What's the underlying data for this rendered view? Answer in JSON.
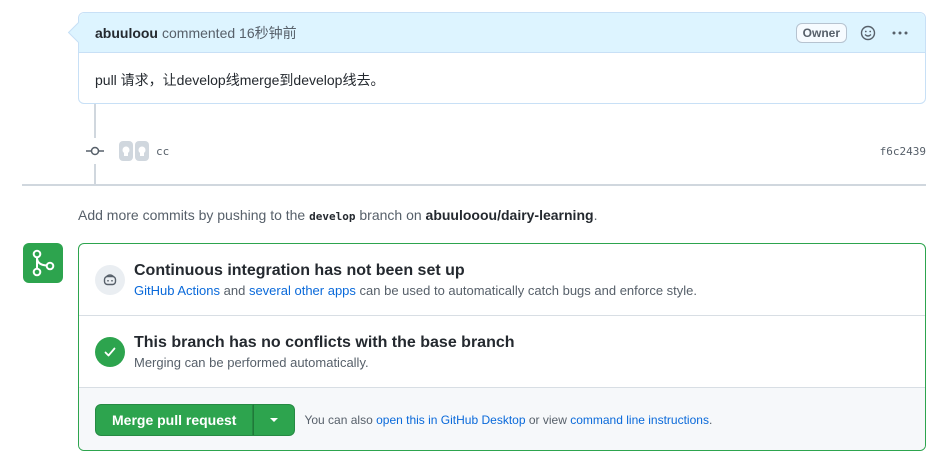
{
  "comment": {
    "author": "abuuloou",
    "meta": "commented 16秒钟前",
    "badge": "Owner",
    "body": "pull 请求，让develop线merge到develop线去。",
    "icons": {
      "emoji": "smiley-icon",
      "menu": "kebab-menu-icon"
    }
  },
  "commit": {
    "message": "cc",
    "sha": "f6c2439",
    "icons": {
      "node": "git-commit-icon",
      "avatar": "github-avatar-icon"
    }
  },
  "hint": {
    "prefix": "Add more commits by pushing to the",
    "branch": "develop",
    "middle": "branch on",
    "repo": "abuulooou/dairy-learning",
    "suffix": "."
  },
  "merge": {
    "icon": "git-merge-icon",
    "ci": {
      "title": "Continuous integration has not been set up",
      "link1": "GitHub Actions",
      "and": "and",
      "link2": "several other apps",
      "rest": "can be used to automatically catch bugs and enforce style.",
      "icon": "bot-icon"
    },
    "conflicts": {
      "title": "This branch has no conflicts with the base branch",
      "sub": "Merging can be performed automatically.",
      "icon": "check-icon"
    },
    "action": {
      "button": "Merge pull request",
      "dropdown_icon": "triangle-down-icon",
      "alt_prefix": "You can also",
      "alt_link1": "open this in GitHub Desktop",
      "alt_middle": "or view",
      "alt_link2": "command line instructions",
      "alt_suffix": "."
    }
  },
  "colors": {
    "accent_green": "#2da44e",
    "link_blue": "#0969da",
    "header_blue": "#ddf4ff"
  }
}
